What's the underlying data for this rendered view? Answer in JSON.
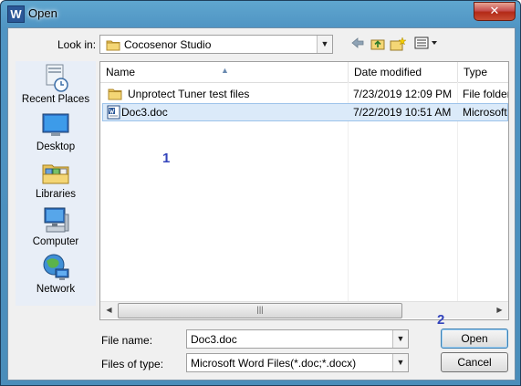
{
  "window": {
    "title": "Open",
    "app_icon_letter": "W",
    "close_glyph": "✕"
  },
  "lookin": {
    "label": "Look in:",
    "value": "Cocosenor Studio"
  },
  "toolbar": {
    "back": "back-icon",
    "up": "up-folder-icon",
    "new_folder": "new-folder-icon",
    "views": "views-menu-icon"
  },
  "places": [
    {
      "label": "Recent Places",
      "icon": "recent-places-icon"
    },
    {
      "label": "Desktop",
      "icon": "desktop-icon"
    },
    {
      "label": "Libraries",
      "icon": "libraries-icon"
    },
    {
      "label": "Computer",
      "icon": "computer-icon"
    },
    {
      "label": "Network",
      "icon": "network-icon"
    }
  ],
  "columns": {
    "name": "Name",
    "date": "Date modified",
    "type": "Type"
  },
  "files": [
    {
      "name": "Unprotect Tuner test files",
      "date": "7/23/2019 12:09 PM",
      "type": "File folder",
      "icon": "folder-icon"
    },
    {
      "name": "Doc3.doc",
      "date": "7/22/2019 10:51 AM",
      "type": "Microsoft",
      "icon": "word-doc-icon",
      "selected": true
    }
  ],
  "annotations": {
    "step1": "1",
    "step2": "2"
  },
  "filename": {
    "label": "File name:",
    "value": "Doc3.doc"
  },
  "filetype": {
    "label": "Files of type:",
    "value": "Microsoft Word Files(*.doc;*.docx)"
  },
  "buttons": {
    "open": "Open",
    "cancel": "Cancel"
  },
  "colors": {
    "selection": "#dbeaf9",
    "annotation": "#3344bb",
    "frame": "#4f94c3"
  }
}
